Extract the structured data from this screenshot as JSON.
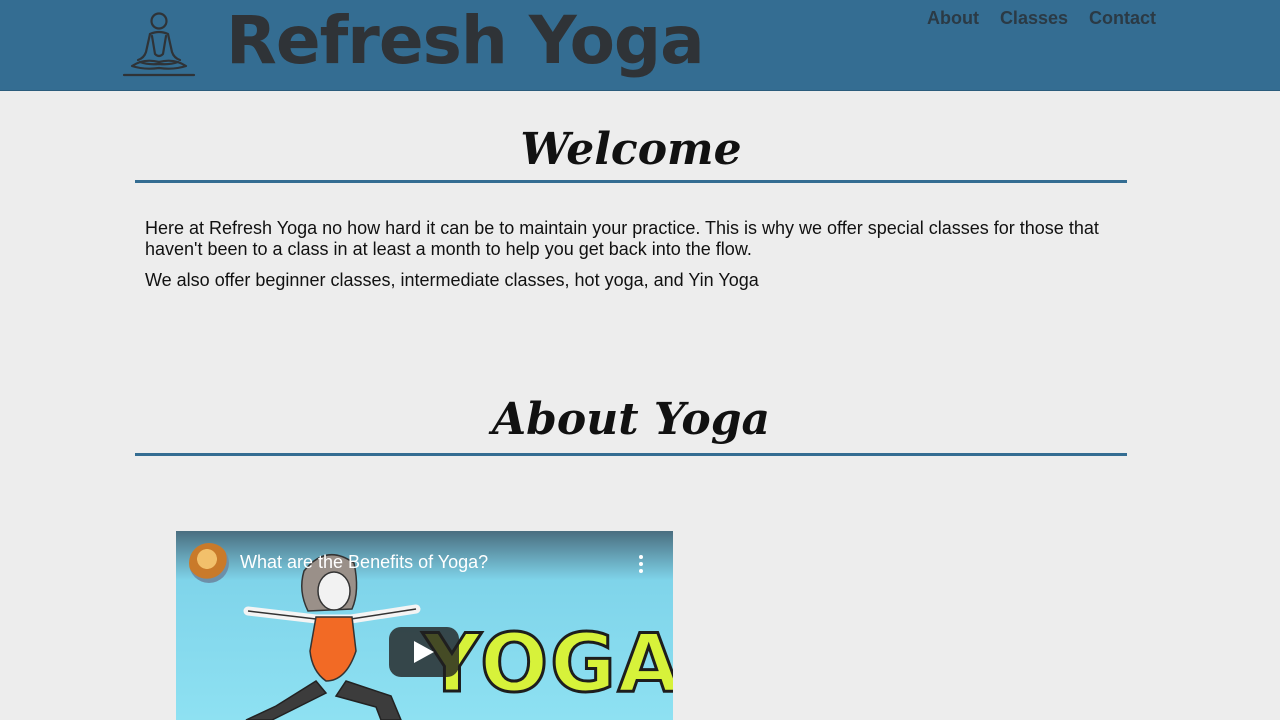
{
  "header": {
    "logo_text": "Refresh Yoga",
    "logo_icon": "meditation-figure-icon",
    "background_color": "#346d92",
    "nav": [
      {
        "label": "About"
      },
      {
        "label": "Classes"
      },
      {
        "label": "Contact"
      }
    ]
  },
  "welcome": {
    "title": "Welcome",
    "paragraphs": [
      "Here at Refresh Yoga no how hard it can be to maintain your practice. This is why we offer special classes for those that haven't been to a class in at least a month to help you get back into the flow.",
      "We also offer beginner classes, intermediate classes, hot yoga, and Yin Yoga"
    ]
  },
  "about": {
    "title": "About Yoga"
  },
  "video": {
    "title": "What are the Benefits of Yoga?",
    "thumbnail_text": "YOGA",
    "play_icon": "play-icon",
    "menu_icon": "more-vert-icon",
    "channel_icon": "channel-avatar"
  },
  "colors": {
    "accent": "#346d92",
    "page_background": "#ededed"
  }
}
